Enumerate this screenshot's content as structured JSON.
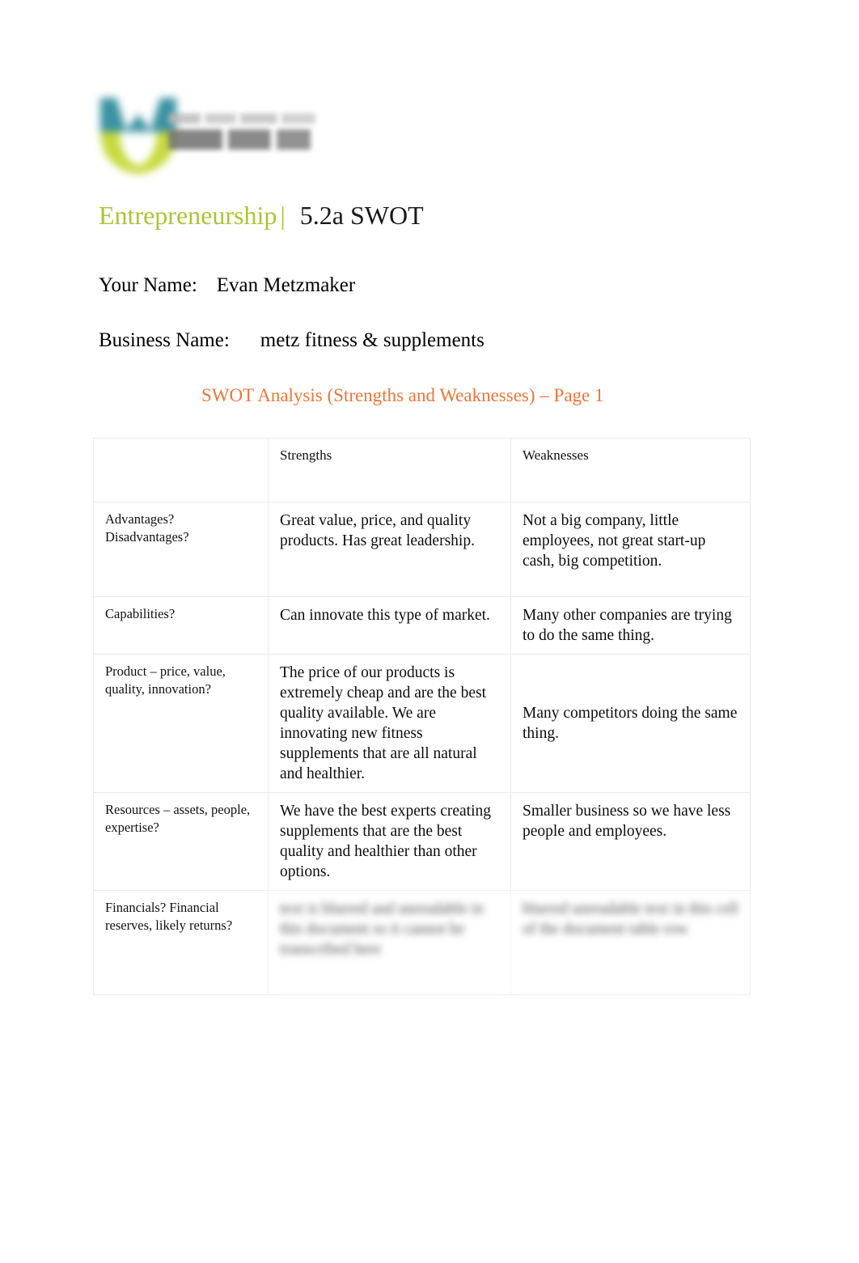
{
  "logo": {
    "name": "michigan-virtual-logo",
    "mark_colors": {
      "top": "#2e8a9b",
      "bottom": "#c2d72e"
    },
    "wordmark_top": "MICHIGAN",
    "wordmark_bottom": "VIRTUAL",
    "legible": false
  },
  "header": {
    "course": "Entrepreneurship",
    "separator": "|",
    "lesson": "5.2a SWOT",
    "course_color": "#acc33a"
  },
  "fields": [
    {
      "label": "Your Name:",
      "value": "Evan Metzmaker"
    },
    {
      "label": "Business Name:",
      "value": "metz fitness & supplements"
    }
  ],
  "section": {
    "subtitle": "SWOT Analysis (Strengths and Weaknesses) – Page 1",
    "subtitle_color": "#e8763b"
  },
  "table": {
    "header": {
      "corner": "",
      "strengths": "Strengths",
      "weaknesses": "Weaknesses",
      "background": "#cbcbcb"
    },
    "rows": [
      {
        "prompt": "Advantages? Disadvantages?",
        "prompt_line1": "Advantages?",
        "prompt_line2": "Disadvantages?",
        "strengths": "Great value, price, and quality products. Has great leadership.",
        "weaknesses": "Not a big company, little employees, not great start-up cash, big competition.",
        "blurred": false
      },
      {
        "prompt": "Capabilities?",
        "strengths": "Can innovate this type of market.",
        "weaknesses": "Many other companies are trying to do the same thing.",
        "blurred": false
      },
      {
        "prompt": "Product – price, value, quality, innovation?",
        "strengths": "The price of our products is extremely cheap and are the best quality available. We are innovating new fitness supplements that are all natural and healthier.",
        "weaknesses": "Many competitors doing the same thing.",
        "blurred": false
      },
      {
        "prompt": "Resources – assets, people, expertise?",
        "strengths": "We have the best experts creating supplements that are the best quality and healthier than other options.",
        "weaknesses": "Smaller business so we have less people and employees.",
        "blurred": false
      },
      {
        "prompt": "Financials? Financial reserves, likely returns?",
        "strengths": "text is blurred and unreadable in this document so it cannot be transcribed here",
        "weaknesses": "blurred unreadable text in this cell of the document table row",
        "blurred": true
      }
    ]
  }
}
